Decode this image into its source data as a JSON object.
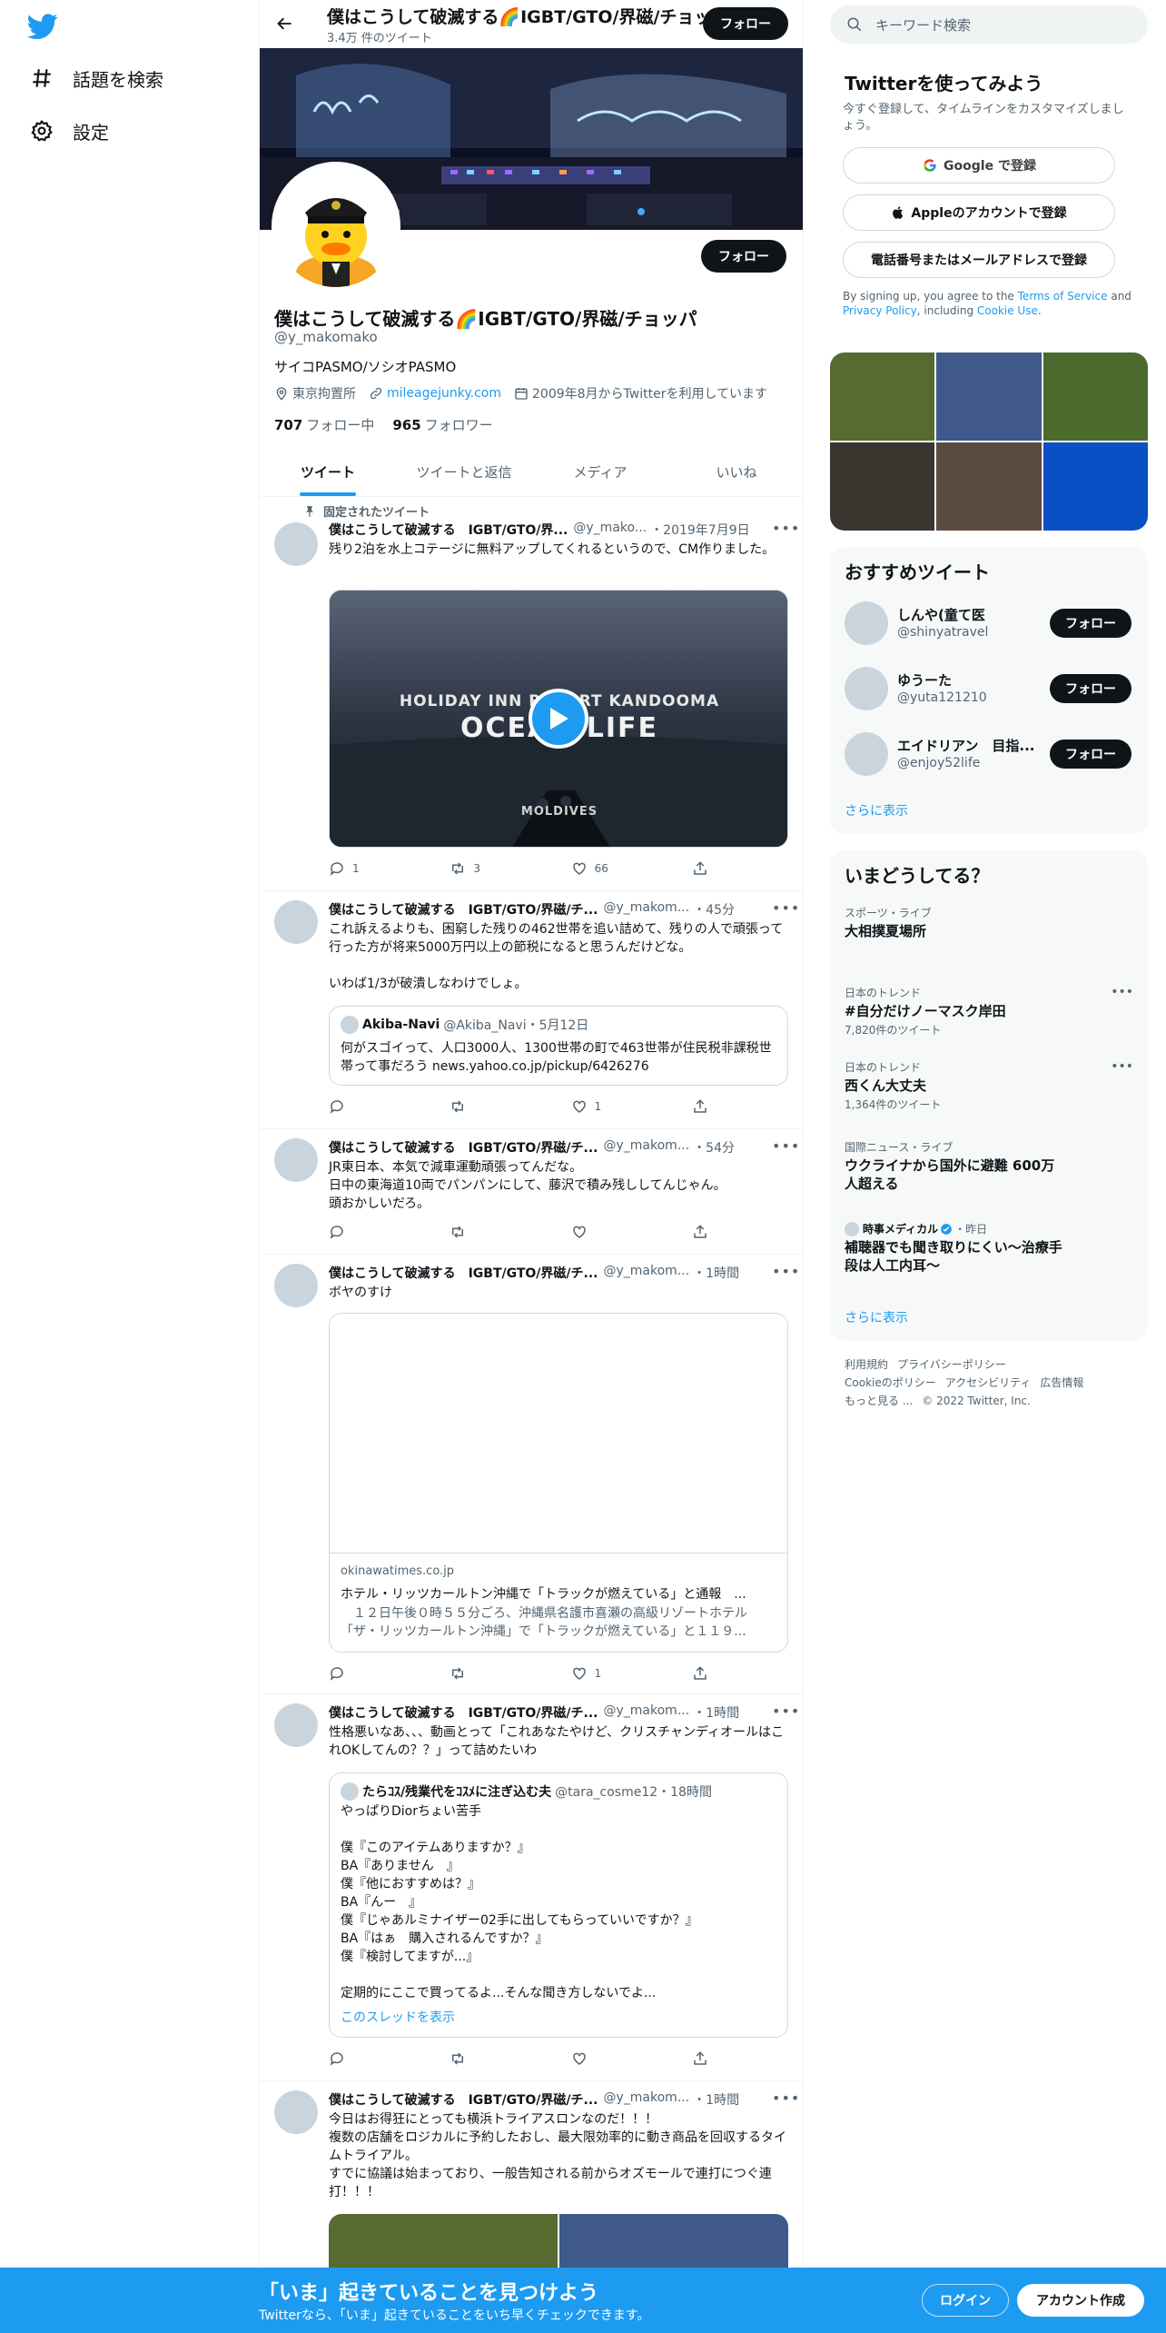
{
  "nav": {
    "explore": "話題を検索",
    "settings": "設定"
  },
  "header": {
    "title": "僕はこうして破滅する🌈IGBT/GTO/界磁/チョッパ",
    "tweet_count": "3.4万 件のツイート",
    "follow": "フォロー"
  },
  "profile": {
    "follow": "フォロー",
    "name": "僕はこうして破滅する🌈IGBT/GTO/界磁/チョッパ",
    "handle": "@y_makomako",
    "bio": "サイコPASMO/ソシオPASMO",
    "location": "東京拘置所",
    "link": "mileagejunky.com",
    "joined": "2009年8月からTwitterを利用しています",
    "following_count": "707",
    "following_label": "フォロー中",
    "followers_count": "965",
    "followers_label": "フォロワー"
  },
  "tabs": [
    "ツイート",
    "ツイートと返信",
    "メディア",
    "いいね"
  ],
  "tweets": [
    {
      "pinned": "固定されたツイート",
      "name": "僕はこうして破滅する　IGBT/GTO/界...",
      "handle": "@y_mako...",
      "date": "・2019年7月9日",
      "text": "残り2泊を水上コテージに無料アップしてくれるというので、CM作りました。",
      "media_text1": "HOLIDAY INN RESORT KANDOOMA",
      "media_text2": "OCEAN LIFE",
      "media_text3": "MOLDIVES",
      "reply": "1",
      "retweet": "3",
      "like": "66"
    },
    {
      "name": "僕はこうして破滅する　IGBT/GTO/界磁/チ...",
      "handle": "@y_makom...",
      "date": "・45分",
      "text": "これ訴えるよりも、困窮した残りの462世帯を追い詰めて、残りの人で頑張って行った方が将来5000万円以上の節税になると思うんだけどな。\n\nいわば1/3が破潰しなわけでしょ。",
      "quote_name": "Akiba-Navi",
      "quote_handle": "@Akiba_Navi・5月12日",
      "quote_text": "何がスゴイって、人口3000人、1300世帯の町で463世帯が住民税非課税世帯って事だろう news.yahoo.co.jp/pickup/6426276",
      "reply": "",
      "retweet": "",
      "like": "1"
    },
    {
      "name": "僕はこうして破滅する　IGBT/GTO/界磁/チ...",
      "handle": "@y_makom...",
      "date": "・54分",
      "text": "JR東日本、本気で減車運動頑張ってんだな。\n日中の東海道10両でパンパンにして、藤沢で積み残ししてんじゃん。\n頭おかしいだろ。",
      "reply": "",
      "retweet": "",
      "like": ""
    },
    {
      "name": "僕はこうして破滅する　IGBT/GTO/界磁/チ...",
      "handle": "@y_makom...",
      "date": "・1時間",
      "text": "ボヤのすけ",
      "card_domain": "okinawatimes.co.jp",
      "card_title": "ホテル・リッツカールトン沖縄で「トラックが燃えている」と通報　...",
      "card_desc": "　１２日午後０時５５分ごろ、沖縄県名護市喜瀬の高級リゾートホテル「ザ・リッツカールトン沖縄」で「トラックが燃えている」と１１９...",
      "reply": "",
      "retweet": "",
      "like": "1"
    },
    {
      "name": "僕はこうして破滅する　IGBT/GTO/界磁/チ...",
      "handle": "@y_makom...",
      "date": "・1時間",
      "text": "性格悪いなあ、、、動画とって「これあなたやけど、クリスチャンディオールはこれOKしてんの？？」って詰めたいわ",
      "quote_name": "たらｺｽ/残業代をｺｽﾒに注ぎ込む夫",
      "quote_handle": "@tara_cosme12・18時間",
      "quote_text": "やっぱりDiorちょい苦手\n\n僕『このアイテムありますか？』\nBA『ありません　』\n僕『他におすすめは？』\nBA『んー　』\n僕『じゃあルミナイザー02手に出してもらっていいですか？』\nBA『はぁ　購入されるんですか？』\n僕『検討してますが...』\n\n定期的にここで買ってるよ...そんな聞き方しないでよ...",
      "quote_thread": "このスレッドを表示",
      "reply": "",
      "retweet": "",
      "like": ""
    },
    {
      "name": "僕はこうして破滅する　IGBT/GTO/界磁/チ...",
      "handle": "@y_makom...",
      "date": "・1時間",
      "text": "今日はお得狂にとっても横浜トライアスロンなのだ！！！\n複数の店舗をロジカルに予約したおし、最大限効率的に動き商品を回収するタイムトライアル。\nすでに協議は始まっており、一般告知される前からオズモールで連打につぐ連打！！！"
    }
  ],
  "right": {
    "search_placeholder": "キーワード検索",
    "signup_title": "Twitterを使ってみよう",
    "signup_sub": "今すぐ登録して、タイムラインをカスタマイズしましょう。",
    "google": "Google で登録",
    "apple": "Appleのアカウントで登録",
    "phone": "電話番号またはメールアドレスで登録",
    "terms_pre": "By signing up, you agree to the ",
    "terms_tos": "Terms of Service",
    "terms_and": " and ",
    "terms_privacy": "Privacy Policy",
    "terms_incl": ", including ",
    "terms_cookie": "Cookie Use",
    "terms_end": ".",
    "grid_colors": [
      "#556b2f",
      "#3f5a8a",
      "#4c6a2e",
      "#3b3530",
      "#5a4a42",
      "#0b4fc4"
    ],
    "rec_title": "おすすめツイート",
    "recs": [
      {
        "name": "しんや(童て医",
        "handle": "@shinyatravel",
        "follow": "フォロー"
      },
      {
        "name": "ゆうーた",
        "handle": "@yuta121210",
        "follow": "フォロー"
      },
      {
        "name": "エイドリアン　目指...",
        "handle": "@enjoy52life",
        "follow": "フォロー"
      }
    ],
    "rec_more": "さらに表示",
    "trend_title": "いまどうしてる？",
    "trends": [
      {
        "cat": "スポーツ・ライブ",
        "name": "大相撲夏場所",
        "count": ""
      },
      {
        "cat": "日本のトレンド",
        "name": "#自分だけノーマスク岸田",
        "count": "7,820件のツイート"
      },
      {
        "cat": "日本のトレンド",
        "name": "西くん大丈夫",
        "count": "1,364件のツイート"
      },
      {
        "cat": "国際ニュース・ライブ",
        "name": "ウクライナから国外に避難 600万人超える",
        "count": ""
      }
    ],
    "news_source": "時事メディカル",
    "news_time": "・昨日",
    "news_title": "補聴器でも聞き取りにくい～治療手段は人工内耳～",
    "trend_more": "さらに表示",
    "footer": [
      "利用規約",
      "プライバシーポリシー",
      "Cookieのポリシー",
      "アクセシビリティ",
      "広告情報",
      "もっと見る ...",
      "© 2022 Twitter, Inc."
    ]
  },
  "bottom": {
    "title": "「いま」起きていることを見つけよう",
    "sub": "Twitterなら、「いま」起きていることをいち早くチェックできます。",
    "login": "ログイン",
    "signup": "アカウント作成"
  }
}
